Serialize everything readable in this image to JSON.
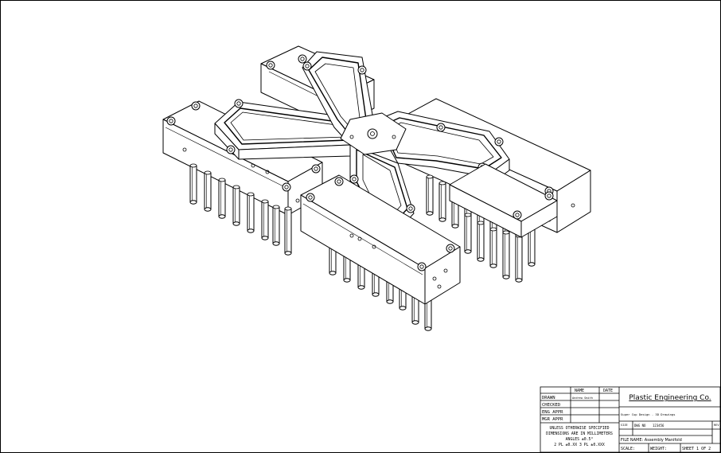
{
  "titleblock": {
    "headers": {
      "name": "NAME",
      "date": "DATE"
    },
    "rows": [
      {
        "label": "DRAWN",
        "name": "Andrew Smith"
      },
      {
        "label": "CHECKED",
        "name": ""
      },
      {
        "label": "ENG APPR",
        "name": ""
      },
      {
        "label": "MGR APPR",
        "name": ""
      }
    ],
    "company": "Plastic Engineering Co.",
    "notes": [
      "UNLESS OTHERWISE SPECIFIED",
      "DIMENSIONS ARE IN MILLIMETERS",
      "ANGLES ±0.5°",
      "2 PL ±0.XX 3 PL ±0.XXX"
    ],
    "title_line": "Super Cup Design - 3D Drawings",
    "size_label": "SIZE",
    "dwg_no_label": "DWG NO",
    "dwg_no": "123456",
    "rev_label": "REV",
    "file_name": "FILE NAME: Assembly Manifold",
    "scale": "SCALE:",
    "weight": "WEIGHT:",
    "sheet": "SHEET 1 OF 2"
  }
}
